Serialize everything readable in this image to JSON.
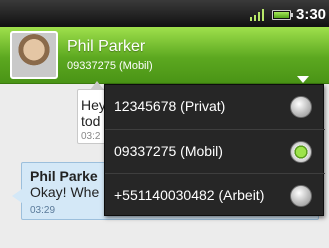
{
  "status_bar": {
    "time": "3:30"
  },
  "header": {
    "contact_name": "Phil Parker",
    "contact_number": "09337275 (Mobil)"
  },
  "thread": {
    "outgoing": {
      "text": "Hey\ntod",
      "time": "03:2"
    },
    "incoming": {
      "sender": "Phil Parke",
      "text": "Okay! Whe",
      "time": "03:29"
    }
  },
  "number_picker": {
    "options": [
      {
        "label": "12345678 (Privat)",
        "selected": false
      },
      {
        "label": "09337275 (Mobil)",
        "selected": true
      },
      {
        "label": "+551140030482 (Arbeit)",
        "selected": false
      }
    ]
  },
  "icons": [
    "signal-icon",
    "battery-icon",
    "avatar",
    "chevron-down-icon"
  ],
  "colors": {
    "accent_green": "#5ca820",
    "popup_bg": "#262626",
    "incoming_bubble": "#d4e8f7"
  }
}
